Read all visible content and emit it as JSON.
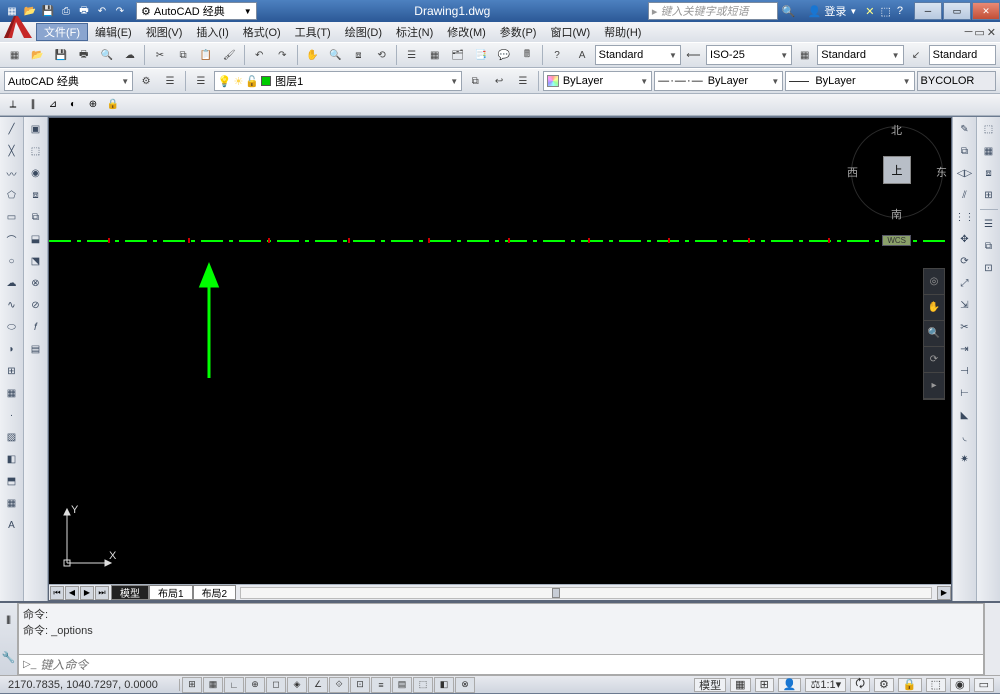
{
  "title": {
    "filename": "Drawing1.dwg",
    "workspace": "AutoCAD 经典",
    "search_placeholder": "键入关键字或短语",
    "login": "登录"
  },
  "menu": [
    "文件(F)",
    "编辑(E)",
    "视图(V)",
    "插入(I)",
    "格式(O)",
    "工具(T)",
    "绘图(D)",
    "标注(N)",
    "修改(M)",
    "参数(P)",
    "窗口(W)",
    "帮助(H)"
  ],
  "styles": {
    "text": "Standard",
    "dim": "ISO-25",
    "table": "Standard",
    "mleader": "Standard"
  },
  "layer": {
    "current": "图层1"
  },
  "props": {
    "color": "ByLayer",
    "ltype": "ByLayer",
    "lweight": "ByLayer",
    "plotstyle": "BYCOLOR"
  },
  "ws_combo": "AutoCAD 经典",
  "viewcube": {
    "n": "北",
    "s": "南",
    "e": "东",
    "w": "西",
    "top": "上"
  },
  "wcs_badge": "WCS",
  "sheet_tabs": {
    "model": "模型",
    "layout1": "布局1",
    "layout2": "布局2"
  },
  "cmd": {
    "line1": "命令:",
    "line2": "命令: _options",
    "prompt_placeholder": "键入命令"
  },
  "status": {
    "coords": "2170.7835, 1040.7297, 0.0000",
    "space": "模型",
    "scale": "1:1"
  },
  "ucs": {
    "x": "X",
    "y": "Y"
  }
}
